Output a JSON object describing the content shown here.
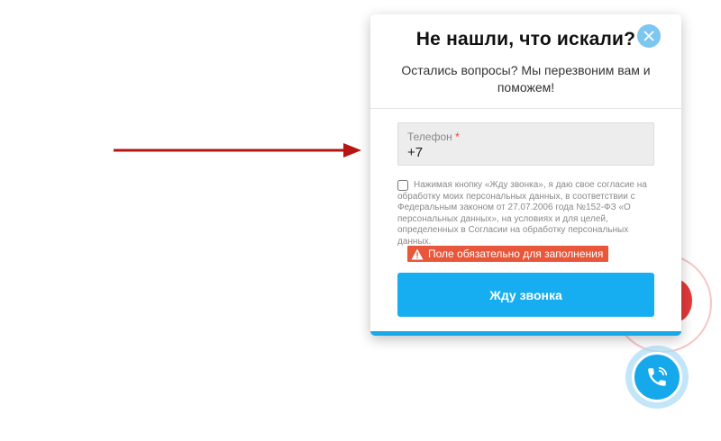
{
  "modal": {
    "title": "Не нашли, что искали?",
    "subtitle": "Остались вопросы? Мы перезвоним вам и поможем!",
    "phone_label": "Телефон",
    "required_mark": "*",
    "phone_value": "+7",
    "consent_text": "Нажимая кнопку «Жду звонка», я даю свое согласие на обработку моих персональных данных, в соответствии с Федеральным законом от 27.07.2006 года №152-ФЗ «О персональных данных», на условиях и для целей, определенных в Согласии на обработку персональных данных.",
    "consent_checked": false,
    "error_text": "Поле обязательно для заполнения",
    "submit_label": "Жду звонка"
  },
  "icons": {
    "close": "close-icon",
    "warning": "warning-icon",
    "phone": "phone-call-icon",
    "arrow": "arrow-right-icon"
  },
  "colors": {
    "accent": "#16aef0",
    "error": "#e8573a",
    "arrow": "#b81414"
  }
}
